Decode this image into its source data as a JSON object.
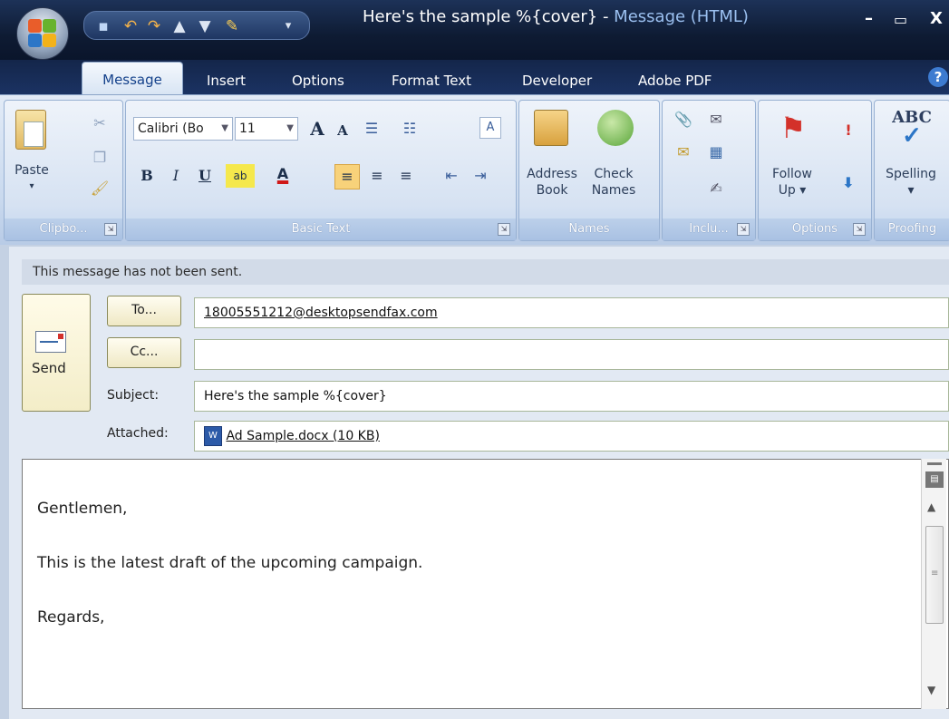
{
  "window": {
    "title": "Here's the sample %{cover}",
    "title_sep": " - ",
    "app": "Message (HTML)",
    "minimize": "–",
    "maximize": "▭",
    "close": "X"
  },
  "tabs": [
    "Message",
    "Insert",
    "Options",
    "Format Text",
    "Developer",
    "Adobe PDF"
  ],
  "help": "?",
  "ribbon": {
    "clipboard": {
      "paste": "Paste",
      "label": "Clipbo..."
    },
    "basic_text": {
      "font": "Calibri (Bo",
      "size": "11",
      "label": "Basic Text"
    },
    "names": {
      "address_book_1": "Address",
      "address_book_2": "Book",
      "check_names_1": "Check",
      "check_names_2": "Names",
      "label": "Names"
    },
    "include": {
      "label": "Inclu..."
    },
    "options": {
      "follow_up_1": "Follow",
      "follow_up_2": "Up",
      "label": "Options"
    },
    "proofing": {
      "spelling": "Spelling",
      "label": "Proofing",
      "abc": "ABC"
    }
  },
  "message": {
    "notice": "This message has not been sent.",
    "send": "Send",
    "to_button": "To...",
    "cc_button": "Cc...",
    "subject_label": "Subject:",
    "attached_label": "Attached:",
    "to": "18005551212@desktopsendfax.com",
    "cc": "",
    "subject": "Here's the sample %{cover}",
    "attachment": "Ad Sample.docx (10 KB)"
  },
  "body_lines": [
    "Gentlemen,",
    "This is the latest draft of the upcoming campaign.",
    "Regards,"
  ]
}
